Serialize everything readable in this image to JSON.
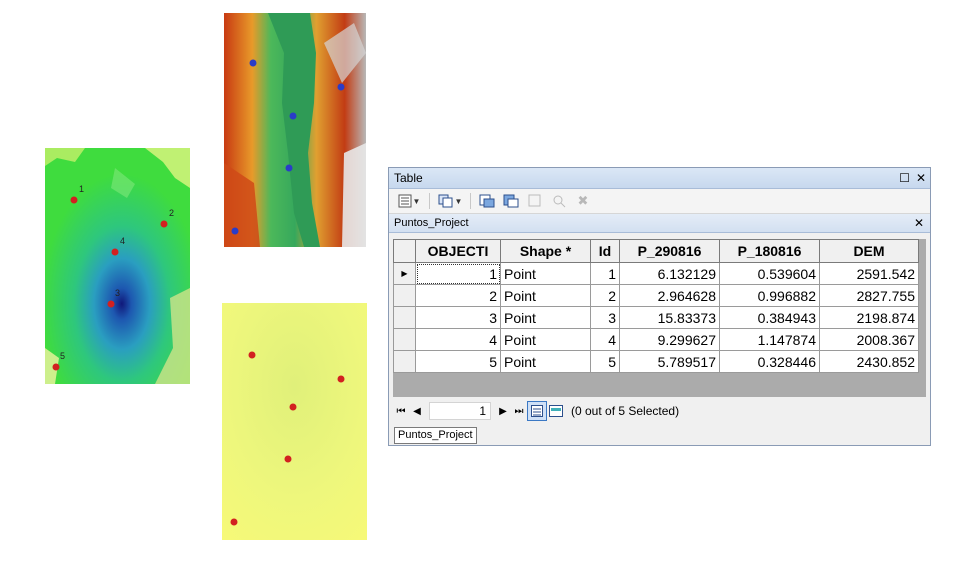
{
  "maps": {
    "left_labels": [
      "1",
      "2",
      "4",
      "3",
      "5"
    ]
  },
  "table_window": {
    "title": "Table",
    "restore_icon": "restore-icon",
    "close_icon": "close-icon",
    "tab_title": "Puntos_Project",
    "columns": [
      "OBJECTI",
      "Shape *",
      "Id",
      "P_290816",
      "P_180816",
      "DEM"
    ],
    "rows": [
      {
        "oid": "1",
        "shape": "Point",
        "id": "1",
        "p29": "6.132129",
        "p18": "0.539604",
        "dem": "2591.542"
      },
      {
        "oid": "2",
        "shape": "Point",
        "id": "2",
        "p29": "2.964628",
        "p18": "0.996882",
        "dem": "2827.755"
      },
      {
        "oid": "3",
        "shape": "Point",
        "id": "3",
        "p29": "15.83373",
        "p18": "0.384943",
        "dem": "2198.874"
      },
      {
        "oid": "4",
        "shape": "Point",
        "id": "4",
        "p29": "9.299627",
        "p18": "1.147874",
        "dem": "2008.367"
      },
      {
        "oid": "5",
        "shape": "Point",
        "id": "5",
        "p29": "5.789517",
        "p18": "0.328446",
        "dem": "2430.852"
      }
    ],
    "current_record": "1",
    "selection_status": "(0 out of 5 Selected)",
    "bottom_tab": "Puntos_Project"
  }
}
